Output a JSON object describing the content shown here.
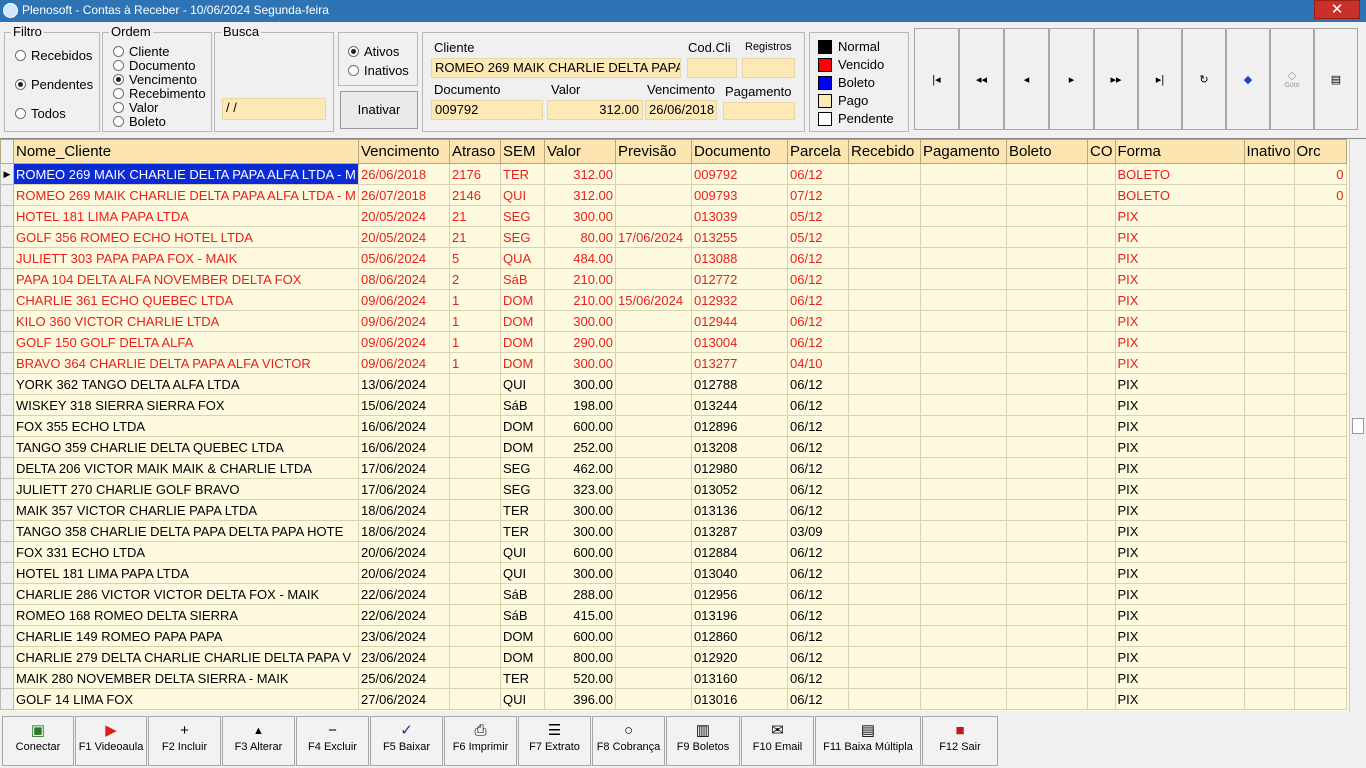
{
  "window": {
    "title": "Plenosoft - Contas à Receber - 10/06/2024 Segunda-feira",
    "close_label": "✕"
  },
  "filtro": {
    "title": "Filtro",
    "options": [
      "Recebidos",
      "Pendentes",
      "Todos"
    ],
    "selected": "Pendentes"
  },
  "ordem": {
    "title": "Ordem",
    "options": [
      "Cliente",
      "Documento",
      "Vencimento",
      "Recebimento",
      "Valor",
      "Boleto"
    ],
    "selected": "Vencimento"
  },
  "busca": {
    "title": "Busca",
    "value": " / /"
  },
  "status_filter": {
    "options": [
      "Ativos",
      "Inativos"
    ],
    "selected": "Ativos"
  },
  "inativar_label": "Inativar",
  "detail": {
    "cliente_label": "Cliente",
    "cliente_value": "ROMEO 269 MAIK CHARLIE DELTA PAPA",
    "codcli_label": "Cod.Cli",
    "codcli_value": "",
    "registros_label": "Registros",
    "registros_value": "",
    "documento_label": "Documento",
    "documento_value": "009792",
    "valor_label": "Valor",
    "valor_value": "312.00",
    "vencimento_label": "Vencimento",
    "vencimento_value": "26/06/2018",
    "pagamento_label": "Pagamento",
    "pagamento_value": ""
  },
  "legend": [
    {
      "label": "Normal",
      "color": "#000000"
    },
    {
      "label": "Vencido",
      "color": "#ff0000"
    },
    {
      "label": "Boleto",
      "color": "#0000ff"
    },
    {
      "label": "Pago",
      "color": "#fce9b6"
    },
    {
      "label": "Pendente",
      "color": "#ffffff"
    }
  ],
  "nav_buttons": [
    {
      "icon": "first-record-icon",
      "glyph": "|◂",
      "label": ""
    },
    {
      "icon": "prior-page-icon",
      "glyph": "◂◂",
      "label": ""
    },
    {
      "icon": "prior-record-icon",
      "glyph": "◂",
      "label": ""
    },
    {
      "icon": "next-record-icon",
      "glyph": "▸",
      "label": ""
    },
    {
      "icon": "next-page-icon",
      "glyph": "▸▸",
      "label": ""
    },
    {
      "icon": "last-record-icon",
      "glyph": "▸|",
      "label": ""
    },
    {
      "icon": "refresh-icon",
      "glyph": "↻",
      "label": ""
    },
    {
      "icon": "eraser-icon",
      "glyph": "◆",
      "label": ""
    },
    {
      "icon": "goto-icon",
      "glyph": "◇",
      "label": "Goto"
    },
    {
      "icon": "report-icon",
      "glyph": "▤",
      "label": ""
    }
  ],
  "grid": {
    "columns": [
      "Nome_Cliente",
      "Vencimento",
      "Atraso",
      "SEM",
      "Valor",
      "Previsão",
      "Documento",
      "Parcela",
      "Recebido",
      "Pagamento",
      "Boleto",
      "CO",
      "Forma",
      "Inativo",
      "Orc"
    ],
    "rows": [
      {
        "status": "vencido",
        "selected": true,
        "cells": [
          "ROMEO 269 MAIK CHARLIE DELTA PAPA ALFA LTDA - M",
          "26/06/2018",
          "2176",
          "TER",
          "312.00",
          "",
          "009792",
          "06/12",
          "",
          "",
          "",
          "",
          "BOLETO",
          "",
          "0"
        ]
      },
      {
        "status": "vencido",
        "cells": [
          "ROMEO 269 MAIK CHARLIE DELTA PAPA ALFA LTDA - M",
          "26/07/2018",
          "2146",
          "QUI",
          "312.00",
          "",
          "009793",
          "07/12",
          "",
          "",
          "",
          "",
          "BOLETO",
          "",
          "0"
        ]
      },
      {
        "status": "vencido",
        "cells": [
          "HOTEL 181 LIMA PAPA LTDA",
          "20/05/2024",
          "21",
          "SEG",
          "300.00",
          "",
          "013039",
          "05/12",
          "",
          "",
          "",
          "",
          "PIX",
          "",
          ""
        ]
      },
      {
        "status": "vencido",
        "cells": [
          "GOLF 356 ROMEO ECHO HOTEL LTDA",
          "20/05/2024",
          "21",
          "SEG",
          "80.00",
          "17/06/2024",
          "013255",
          "05/12",
          "",
          "",
          "",
          "",
          "PIX",
          "",
          ""
        ]
      },
      {
        "status": "vencido",
        "cells": [
          "JULIETT 303 PAPA PAPA FOX - MAIK",
          "05/06/2024",
          "5",
          "QUA",
          "484.00",
          "",
          "013088",
          "06/12",
          "",
          "",
          "",
          "",
          "PIX",
          "",
          ""
        ]
      },
      {
        "status": "vencido",
        "cells": [
          "PAPA 104 DELTA ALFA NOVEMBER DELTA FOX",
          "08/06/2024",
          "2",
          "SáB",
          "210.00",
          "",
          "012772",
          "06/12",
          "",
          "",
          "",
          "",
          "PIX",
          "",
          ""
        ]
      },
      {
        "status": "vencido",
        "cells": [
          "CHARLIE 361 ECHO QUEBEC LTDA",
          "09/06/2024",
          "1",
          "DOM",
          "210.00",
          "15/06/2024",
          "012932",
          "06/12",
          "",
          "",
          "",
          "",
          "PIX",
          "",
          ""
        ]
      },
      {
        "status": "vencido",
        "cells": [
          "KILO 360 VICTOR CHARLIE LTDA",
          "09/06/2024",
          "1",
          "DOM",
          "300.00",
          "",
          "012944",
          "06/12",
          "",
          "",
          "",
          "",
          "PIX",
          "",
          ""
        ]
      },
      {
        "status": "vencido",
        "cells": [
          "GOLF 150 GOLF DELTA ALFA",
          "09/06/2024",
          "1",
          "DOM",
          "290.00",
          "",
          "013004",
          "06/12",
          "",
          "",
          "",
          "",
          "PIX",
          "",
          ""
        ]
      },
      {
        "status": "vencido",
        "cells": [
          "BRAVO 364 CHARLIE DELTA PAPA ALFA VICTOR",
          "09/06/2024",
          "1",
          "DOM",
          "300.00",
          "",
          "013277",
          "04/10",
          "",
          "",
          "",
          "",
          "PIX",
          "",
          ""
        ]
      },
      {
        "status": "normal",
        "cells": [
          "YORK 362 TANGO DELTA ALFA LTDA",
          "13/06/2024",
          "",
          "QUI",
          "300.00",
          "",
          "012788",
          "06/12",
          "",
          "",
          "",
          "",
          "PIX",
          "",
          ""
        ]
      },
      {
        "status": "normal",
        "cells": [
          "WISKEY 318 SIERRA SIERRA FOX",
          "15/06/2024",
          "",
          "SáB",
          "198.00",
          "",
          "013244",
          "06/12",
          "",
          "",
          "",
          "",
          "PIX",
          "",
          ""
        ]
      },
      {
        "status": "normal",
        "cells": [
          "FOX 355 ECHO LTDA",
          "16/06/2024",
          "",
          "DOM",
          "600.00",
          "",
          "012896",
          "06/12",
          "",
          "",
          "",
          "",
          "PIX",
          "",
          ""
        ]
      },
      {
        "status": "normal",
        "cells": [
          "TANGO 359 CHARLIE DELTA QUEBEC LTDA",
          "16/06/2024",
          "",
          "DOM",
          "252.00",
          "",
          "013208",
          "06/12",
          "",
          "",
          "",
          "",
          "PIX",
          "",
          ""
        ]
      },
      {
        "status": "normal",
        "cells": [
          "DELTA 206 VICTOR MAIK MAIK & CHARLIE LTDA",
          "17/06/2024",
          "",
          "SEG",
          "462.00",
          "",
          "012980",
          "06/12",
          "",
          "",
          "",
          "",
          "PIX",
          "",
          ""
        ]
      },
      {
        "status": "normal",
        "cells": [
          "JULIETT 270 CHARLIE GOLF BRAVO",
          "17/06/2024",
          "",
          "SEG",
          "323.00",
          "",
          "013052",
          "06/12",
          "",
          "",
          "",
          "",
          "PIX",
          "",
          ""
        ]
      },
      {
        "status": "normal",
        "cells": [
          "MAIK 357 VICTOR CHARLIE PAPA LTDA",
          "18/06/2024",
          "",
          "TER",
          "300.00",
          "",
          "013136",
          "06/12",
          "",
          "",
          "",
          "",
          "PIX",
          "",
          ""
        ]
      },
      {
        "status": "normal",
        "cells": [
          "TANGO 358 CHARLIE DELTA PAPA DELTA PAPA HOTE",
          "18/06/2024",
          "",
          "TER",
          "300.00",
          "",
          "013287",
          "03/09",
          "",
          "",
          "",
          "",
          "PIX",
          "",
          ""
        ]
      },
      {
        "status": "normal",
        "cells": [
          "FOX 331 ECHO LTDA",
          "20/06/2024",
          "",
          "QUI",
          "600.00",
          "",
          "012884",
          "06/12",
          "",
          "",
          "",
          "",
          "PIX",
          "",
          ""
        ]
      },
      {
        "status": "normal",
        "cells": [
          "HOTEL 181 LIMA PAPA LTDA",
          "20/06/2024",
          "",
          "QUI",
          "300.00",
          "",
          "013040",
          "06/12",
          "",
          "",
          "",
          "",
          "PIX",
          "",
          ""
        ]
      },
      {
        "status": "normal",
        "cells": [
          "CHARLIE 286 VICTOR VICTOR DELTA FOX - MAIK",
          "22/06/2024",
          "",
          "SáB",
          "288.00",
          "",
          "012956",
          "06/12",
          "",
          "",
          "",
          "",
          "PIX",
          "",
          ""
        ]
      },
      {
        "status": "normal",
        "cells": [
          "ROMEO 168 ROMEO DELTA SIERRA",
          "22/06/2024",
          "",
          "SáB",
          "415.00",
          "",
          "013196",
          "06/12",
          "",
          "",
          "",
          "",
          "PIX",
          "",
          ""
        ]
      },
      {
        "status": "normal",
        "cells": [
          "CHARLIE 149 ROMEO PAPA PAPA",
          "23/06/2024",
          "",
          "DOM",
          "600.00",
          "",
          "012860",
          "06/12",
          "",
          "",
          "",
          "",
          "PIX",
          "",
          ""
        ]
      },
      {
        "status": "normal",
        "cells": [
          "CHARLIE 279 DELTA CHARLIE CHARLIE DELTA PAPA V",
          "23/06/2024",
          "",
          "DOM",
          "800.00",
          "",
          "012920",
          "06/12",
          "",
          "",
          "",
          "",
          "PIX",
          "",
          ""
        ]
      },
      {
        "status": "normal",
        "cells": [
          "MAIK 280 NOVEMBER DELTA SIERRA - MAIK",
          "25/06/2024",
          "",
          "TER",
          "520.00",
          "",
          "013160",
          "06/12",
          "",
          "",
          "",
          "",
          "PIX",
          "",
          ""
        ]
      },
      {
        "status": "normal",
        "cells": [
          "GOLF 14 LIMA FOX",
          "27/06/2024",
          "",
          "QUI",
          "396.00",
          "",
          "013016",
          "06/12",
          "",
          "",
          "",
          "",
          "PIX",
          "",
          ""
        ]
      }
    ]
  },
  "function_buttons": [
    {
      "label": "Conectar",
      "icon": "connect-icon",
      "glyph": "▣"
    },
    {
      "label": "F1 Videoaula",
      "icon": "youtube-icon",
      "glyph": "▶"
    },
    {
      "label": "F2 Incluir",
      "icon": "plus-icon",
      "glyph": "+"
    },
    {
      "label": "F3 Alterar",
      "icon": "up-arrow-icon",
      "glyph": "▲"
    },
    {
      "label": "F4 Excluir",
      "icon": "minus-icon",
      "glyph": "−"
    },
    {
      "label": "F5 Baixar",
      "icon": "check-document-icon",
      "glyph": "✓"
    },
    {
      "label": "F6 Imprimir",
      "icon": "printer-icon",
      "glyph": "⎙"
    },
    {
      "label": "F7 Extrato",
      "icon": "list-icon",
      "glyph": "☰"
    },
    {
      "label": "F8 Cobrança",
      "icon": "speech-bubble-icon",
      "glyph": "○"
    },
    {
      "label": "F9 Boletos",
      "icon": "barcode-icon",
      "glyph": "▥"
    },
    {
      "label": "F10 Email",
      "icon": "envelope-icon",
      "glyph": "✉"
    },
    {
      "label": "F11 Baixa Múltipla",
      "icon": "stack-icon",
      "glyph": "▤"
    },
    {
      "label": "F12 Sair",
      "icon": "exit-door-icon",
      "glyph": "■"
    }
  ]
}
